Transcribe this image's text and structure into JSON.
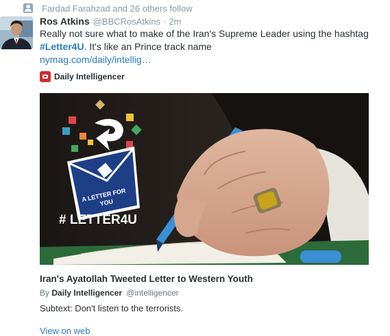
{
  "context": {
    "icon": "user-follow-icon",
    "text": "Fardad Farahzad and 26 others follow"
  },
  "tweet": {
    "fullname": "Ros Atkins",
    "username": "@BBCRosAtkins",
    "separator": "·",
    "time": "2m",
    "text_part1": "Really not sure what to make of the Iran's Supreme Leader using the hashtag",
    "hashtag": "#Letter4U",
    "text_part2": ". It's like an Prince track name",
    "link": "nymag.com/daily/intellig…"
  },
  "card": {
    "source_name": "Daily Intelligencer",
    "image": {
      "letter_label_line1": "A LETTER FOR",
      "letter_label_line2": "YOU",
      "hashtag_text": "# LETTER4U",
      "colors": {
        "envelope": "#1e3f86",
        "confetti_red": "#e0454a",
        "confetti_yellow": "#f2c230",
        "confetti_teal": "#3a9fc6",
        "confetti_green": "#43a85e"
      }
    },
    "title": "Iran's Ayatollah Tweeted Letter to Western Youth",
    "byline_prefix": "By",
    "byline_author": "Daily Intelligencer",
    "byline_handle": "@intelligencer",
    "description": "Subtext: Don't listen to the terrorists.",
    "view_link": "View on web"
  }
}
